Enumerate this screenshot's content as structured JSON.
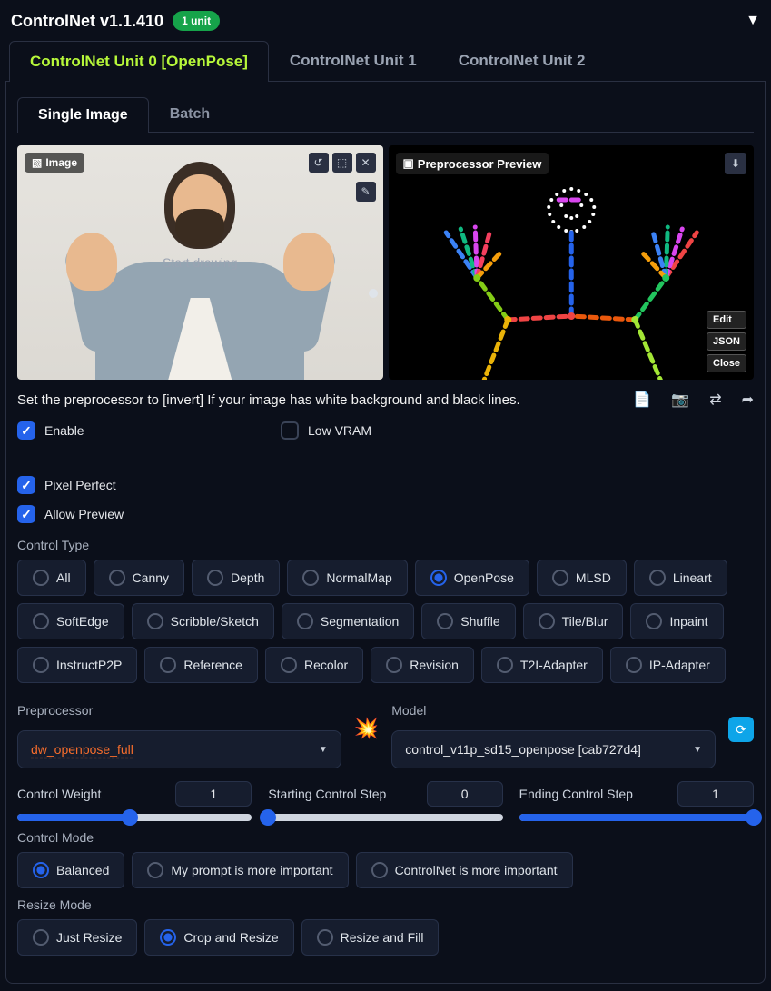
{
  "header": {
    "title": "ControlNet v1.1.410",
    "badge": "1 unit"
  },
  "outer_tabs": [
    "ControlNet Unit 0 [OpenPose]",
    "ControlNet Unit 1",
    "ControlNet Unit 2"
  ],
  "inner_tabs": [
    "Single Image",
    "Batch"
  ],
  "image_area": {
    "source_label": "Image",
    "preview_label": "Preprocessor Preview",
    "start_drawing": "Start drawing",
    "side_buttons": [
      "Edit",
      "JSON",
      "Close"
    ]
  },
  "hint": "Set the preprocessor to [invert] If your image has white background and black lines.",
  "checkboxes": {
    "enable": {
      "label": "Enable",
      "checked": true
    },
    "low_vram": {
      "label": "Low VRAM",
      "checked": false
    },
    "pixel_perfect": {
      "label": "Pixel Perfect",
      "checked": true
    },
    "allow_preview": {
      "label": "Allow Preview",
      "checked": true
    }
  },
  "control_type": {
    "label": "Control Type",
    "options": [
      "All",
      "Canny",
      "Depth",
      "NormalMap",
      "OpenPose",
      "MLSD",
      "Lineart",
      "SoftEdge",
      "Scribble/Sketch",
      "Segmentation",
      "Shuffle",
      "Tile/Blur",
      "Inpaint",
      "InstructP2P",
      "Reference",
      "Recolor",
      "Revision",
      "T2I-Adapter",
      "IP-Adapter"
    ],
    "selected": "OpenPose"
  },
  "preprocessor": {
    "label": "Preprocessor",
    "value": "dw_openpose_full"
  },
  "model": {
    "label": "Model",
    "value": "control_v11p_sd15_openpose [cab727d4]"
  },
  "sliders": {
    "control_weight": {
      "label": "Control Weight",
      "value": "1",
      "fill": 48
    },
    "start_step": {
      "label": "Starting Control Step",
      "value": "0",
      "fill": 0
    },
    "end_step": {
      "label": "Ending Control Step",
      "value": "1",
      "fill": 100
    }
  },
  "control_mode": {
    "label": "Control Mode",
    "options": [
      "Balanced",
      "My prompt is more important",
      "ControlNet is more important"
    ],
    "selected": "Balanced"
  },
  "resize_mode": {
    "label": "Resize Mode",
    "options": [
      "Just Resize",
      "Crop and Resize",
      "Resize and Fill"
    ],
    "selected": "Crop and Resize"
  }
}
